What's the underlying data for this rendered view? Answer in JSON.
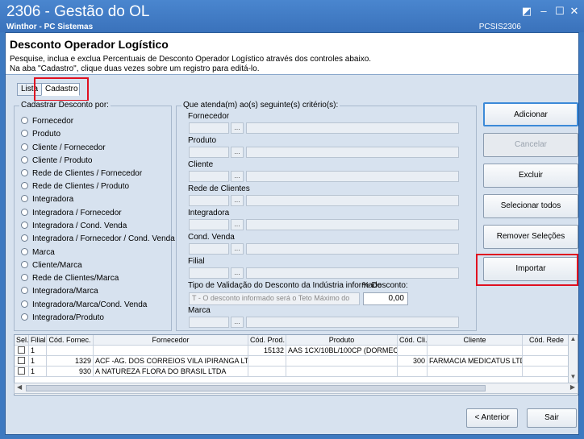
{
  "window": {
    "title": "2306 - Gestão do OL",
    "subtitle": "Winthor - PC Sistemas",
    "code": "PCSIS2306",
    "controls": [
      "pin-icon",
      "minimize-icon",
      "maximize-icon",
      "close-icon"
    ]
  },
  "header": {
    "title": "Desconto Operador Logístico",
    "description": "Pesquise, inclua e exclua Percentuais de Desconto Operador Logístico através dos controles abaixo.",
    "hint": "Na aba \"Cadastro\", clique duas vezes sobre um registro para editá-lo."
  },
  "tabs": [
    {
      "label": "Lista"
    },
    {
      "label": "Cadastro"
    }
  ],
  "cadastrar": {
    "title": "Cadastrar Desconto por:",
    "options": [
      "Fornecedor",
      "Produto",
      "Cliente / Fornecedor",
      "Cliente / Produto",
      "Rede de Clientes / Fornecedor",
      "Rede de Clientes / Produto",
      "Integradora",
      "Integradora / Fornecedor",
      "Integradora / Cond. Venda",
      "Integradora / Fornecedor / Cond. Venda",
      "Marca",
      "Cliente/Marca",
      "Rede de Clientes/Marca",
      "Integradora/Marca",
      "Integradora/Marca/Cond. Venda",
      "Integradora/Produto"
    ]
  },
  "criterios": {
    "title": "Que atenda(m) ao(s) seguinte(s) critério(s):",
    "fields": [
      "Fornecedor",
      "Produto",
      "Cliente",
      "Rede de Clientes",
      "Integradora",
      "Cond. Venda",
      "Filial"
    ],
    "lookup_label": "...",
    "tipo_label": "Tipo de Validação do Desconto da Indústria informado",
    "tipo_value": "T - O desconto informado será o Teto Máximo do",
    "desconto_label": "% Desconto:",
    "desconto_value": "0,00",
    "marca_label": "Marca"
  },
  "buttons": {
    "adicionar": "Adicionar",
    "cancelar": "Cancelar",
    "excluir": "Excluir",
    "selecionar": "Selecionar todos",
    "remover": "Remover Seleções",
    "importar": "Importar",
    "anterior": "< Anterior",
    "sair": "Sair"
  },
  "grid": {
    "columns": [
      "Sel.",
      "Filial",
      "Cód. Fornec.",
      "Fornecedor",
      "Cód. Prod.",
      "Produto",
      "Cód. Cli.",
      "Cliente",
      "Cód. Rede"
    ],
    "rows": [
      {
        "filial": "1",
        "cod_fornec": "",
        "fornecedor": "",
        "cod_prod": "15132",
        "produto": "AAS  1CX/10BL/100CP (DORMEC)",
        "cod_cli": "",
        "cliente": ""
      },
      {
        "filial": "1",
        "cod_fornec": "1329",
        "fornecedor": "ACF -AG. DOS CORREIOS VILA IPIRANGA LTDA",
        "cod_prod": "",
        "produto": "",
        "cod_cli": "300",
        "cliente": "FARMACIA MEDICATUS LTDA"
      },
      {
        "filial": "1",
        "cod_fornec": "930",
        "fornecedor": "A NATUREZA FLORA DO BRASIL LTDA",
        "cod_prod": "",
        "produto": "",
        "cod_cli": "",
        "cliente": ""
      }
    ]
  }
}
